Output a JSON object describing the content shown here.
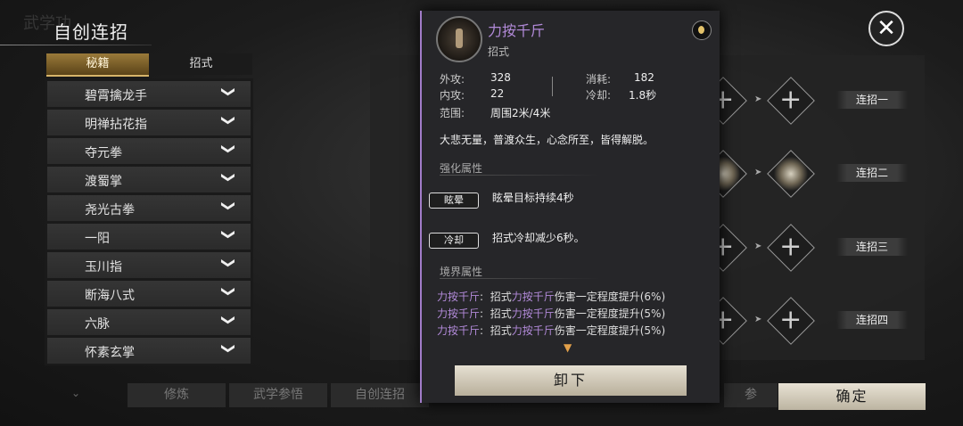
{
  "header": {
    "title": "自创连招",
    "ghost": "武学功"
  },
  "tabs": {
    "active": "秘籍",
    "inactive": "招式"
  },
  "skill_list": [
    "碧霄擒龙手",
    "明禅拈花指",
    "夺元拳",
    "渡蜀掌",
    "尧光古拳",
    "一阳",
    "玉川指",
    "断海八式",
    "六脉",
    "怀素玄掌"
  ],
  "combo_labels": [
    "连招一",
    "连招二",
    "连招三",
    "连招四"
  ],
  "bottom_bar": {
    "btn1": "修炼",
    "btn2": "武学参悟",
    "btn3": "自创连招",
    "btn4": "参"
  },
  "confirm": "确定",
  "popup": {
    "name": "力按千斤",
    "type": "招式",
    "stats": {
      "outer_attack_label": "外攻:",
      "outer_attack": "328",
      "inner_attack_label": "内攻:",
      "inner_attack": "22",
      "range_label": "范围:",
      "range": "周围2米/4米",
      "cost_label": "消耗:",
      "cost": "182",
      "cooldown_label": "冷却:",
      "cooldown": "1.8秒"
    },
    "description": "大悲无量，普渡众生，心念所至，皆得解脱。",
    "enhance_title": "强化属性",
    "enhancements": [
      {
        "badge": "眩晕",
        "text": "眩晕目标持续4秒"
      },
      {
        "badge": "冷却",
        "text": "招式冷却减少6秒。"
      }
    ],
    "realm_title": "境界属性",
    "realm": [
      {
        "src": "力按千斤",
        "colon": ":",
        "pre": "招式",
        "skill": "力按千斤",
        "post": "伤害一定程度提升(6%)"
      },
      {
        "src": "力按千斤",
        "colon": ":",
        "pre": "招式",
        "skill": "力按千斤",
        "post": "伤害一定程度提升(5%)"
      },
      {
        "src": "力按千斤",
        "colon": ":",
        "pre": "招式",
        "skill": "力按千斤",
        "post": "伤害一定程度提升(5%)"
      }
    ],
    "unequip": "卸下"
  },
  "colors": {
    "accent_purple": "#b28ad9",
    "gold": "#d7b56a"
  }
}
